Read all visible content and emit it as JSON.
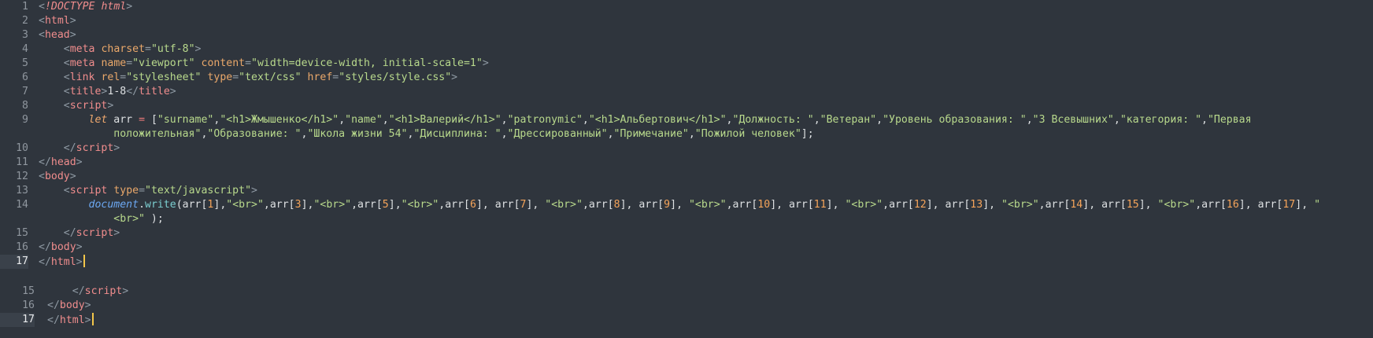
{
  "top": {
    "lines": [
      {
        "n": "1",
        "tokens": [
          [
            "b",
            "<"
          ],
          [
            "doc",
            "!DOCTYPE"
          ],
          [
            "p",
            " "
          ],
          [
            "doc",
            "html"
          ],
          [
            "b",
            ">"
          ]
        ]
      },
      {
        "n": "2",
        "tokens": [
          [
            "b",
            "<"
          ],
          [
            "t",
            "html"
          ],
          [
            "b",
            ">"
          ]
        ]
      },
      {
        "n": "3",
        "tokens": [
          [
            "b",
            "<"
          ],
          [
            "t",
            "head"
          ],
          [
            "b",
            ">"
          ]
        ]
      },
      {
        "n": "4",
        "tokens": [
          [
            "p",
            "    "
          ],
          [
            "b",
            "<"
          ],
          [
            "t",
            "meta"
          ],
          [
            "p",
            " "
          ],
          [
            "a",
            "charset"
          ],
          [
            "b",
            "="
          ],
          [
            "s",
            "\"utf-8\""
          ],
          [
            "b",
            ">"
          ]
        ]
      },
      {
        "n": "5",
        "tokens": [
          [
            "p",
            "    "
          ],
          [
            "b",
            "<"
          ],
          [
            "t",
            "meta"
          ],
          [
            "p",
            " "
          ],
          [
            "a",
            "name"
          ],
          [
            "b",
            "="
          ],
          [
            "s",
            "\"viewport\""
          ],
          [
            "p",
            " "
          ],
          [
            "a",
            "content"
          ],
          [
            "b",
            "="
          ],
          [
            "s",
            "\"width=device-width, initial-scale=1\""
          ],
          [
            "b",
            ">"
          ]
        ]
      },
      {
        "n": "6",
        "tokens": [
          [
            "p",
            "    "
          ],
          [
            "b",
            "<"
          ],
          [
            "t",
            "link"
          ],
          [
            "p",
            " "
          ],
          [
            "a",
            "rel"
          ],
          [
            "b",
            "="
          ],
          [
            "s",
            "\"stylesheet\""
          ],
          [
            "p",
            " "
          ],
          [
            "a",
            "type"
          ],
          [
            "b",
            "="
          ],
          [
            "s",
            "\"text/css\""
          ],
          [
            "p",
            " "
          ],
          [
            "a",
            "href"
          ],
          [
            "b",
            "="
          ],
          [
            "s",
            "\"styles/style.css\""
          ],
          [
            "b",
            ">"
          ]
        ]
      },
      {
        "n": "7",
        "tokens": [
          [
            "p",
            "    "
          ],
          [
            "b",
            "<"
          ],
          [
            "t",
            "title"
          ],
          [
            "b",
            ">"
          ],
          [
            "p",
            "1-8"
          ],
          [
            "b",
            "</"
          ],
          [
            "t",
            "title"
          ],
          [
            "b",
            ">"
          ]
        ]
      },
      {
        "n": "8",
        "tokens": [
          [
            "p",
            "    "
          ],
          [
            "b",
            "<"
          ],
          [
            "t",
            "script"
          ],
          [
            "b",
            ">"
          ]
        ]
      },
      {
        "n": "9",
        "tokens": [
          [
            "p",
            "        "
          ],
          [
            "k",
            "let"
          ],
          [
            "p",
            " arr "
          ],
          [
            "o",
            "="
          ],
          [
            "p",
            " ["
          ],
          [
            "s",
            "\"surname\""
          ],
          [
            "p",
            ","
          ],
          [
            "s",
            "\"<h1>Жмышенко</h1>\""
          ],
          [
            "p",
            ","
          ],
          [
            "s",
            "\"name\""
          ],
          [
            "p",
            ","
          ],
          [
            "s",
            "\"<h1>Валерий</h1>\""
          ],
          [
            "p",
            ","
          ],
          [
            "s",
            "\"patronymic\""
          ],
          [
            "p",
            ","
          ],
          [
            "s",
            "\"<h1>Альбертович</h1>\""
          ],
          [
            "p",
            ","
          ],
          [
            "s",
            "\"Должность: \""
          ],
          [
            "p",
            ","
          ],
          [
            "s",
            "\"Ветеран\""
          ],
          [
            "p",
            ","
          ],
          [
            "s",
            "\"Уровень образования: \""
          ],
          [
            "p",
            ","
          ],
          [
            "s",
            "\"3 Всевышних\""
          ],
          [
            "p",
            ","
          ],
          [
            "s",
            "\"категория: \""
          ],
          [
            "p",
            ","
          ],
          [
            "s",
            "\"Первая"
          ]
        ]
      },
      {
        "n": "",
        "tokens": [
          [
            "p",
            "            "
          ],
          [
            "s",
            "положительная\""
          ],
          [
            "p",
            ","
          ],
          [
            "s",
            "\"Образование: \""
          ],
          [
            "p",
            ","
          ],
          [
            "s",
            "\"Школа жизни 54\""
          ],
          [
            "p",
            ","
          ],
          [
            "s",
            "\"Дисциплина: \""
          ],
          [
            "p",
            ","
          ],
          [
            "s",
            "\"Дрессированный\""
          ],
          [
            "p",
            ","
          ],
          [
            "s",
            "\"Примечание\""
          ],
          [
            "p",
            ","
          ],
          [
            "s",
            "\"Пожилой человек\""
          ],
          [
            "p",
            "];"
          ]
        ]
      },
      {
        "n": "10",
        "tokens": [
          [
            "p",
            "    "
          ],
          [
            "b",
            "</"
          ],
          [
            "t",
            "script"
          ],
          [
            "b",
            ">"
          ]
        ]
      },
      {
        "n": "11",
        "tokens": [
          [
            "b",
            "</"
          ],
          [
            "t",
            "head"
          ],
          [
            "b",
            ">"
          ]
        ]
      },
      {
        "n": "12",
        "tokens": [
          [
            "b",
            "<"
          ],
          [
            "t",
            "body"
          ],
          [
            "b",
            ">"
          ]
        ]
      },
      {
        "n": "13",
        "tokens": [
          [
            "p",
            "    "
          ],
          [
            "b",
            "<"
          ],
          [
            "t",
            "script"
          ],
          [
            "p",
            " "
          ],
          [
            "a",
            "type"
          ],
          [
            "b",
            "="
          ],
          [
            "s",
            "\"text/javascript\""
          ],
          [
            "b",
            ">"
          ]
        ]
      },
      {
        "n": "14",
        "tokens": [
          [
            "p",
            "        "
          ],
          [
            "d",
            "document"
          ],
          [
            "p",
            "."
          ],
          [
            "f",
            "write"
          ],
          [
            "p",
            "(arr["
          ],
          [
            "n",
            "1"
          ],
          [
            "p",
            "],"
          ],
          [
            "s",
            "\"<br>\""
          ],
          [
            "p",
            ",arr["
          ],
          [
            "n",
            "3"
          ],
          [
            "p",
            "],"
          ],
          [
            "s",
            "\"<br>\""
          ],
          [
            "p",
            ",arr["
          ],
          [
            "n",
            "5"
          ],
          [
            "p",
            "],"
          ],
          [
            "s",
            "\"<br>\""
          ],
          [
            "p",
            ",arr["
          ],
          [
            "n",
            "6"
          ],
          [
            "p",
            "], arr["
          ],
          [
            "n",
            "7"
          ],
          [
            "p",
            "], "
          ],
          [
            "s",
            "\"<br>\""
          ],
          [
            "p",
            ",arr["
          ],
          [
            "n",
            "8"
          ],
          [
            "p",
            "], arr["
          ],
          [
            "n",
            "9"
          ],
          [
            "p",
            "], "
          ],
          [
            "s",
            "\"<br>\""
          ],
          [
            "p",
            ",arr["
          ],
          [
            "n",
            "10"
          ],
          [
            "p",
            "], arr["
          ],
          [
            "n",
            "11"
          ],
          [
            "p",
            "], "
          ],
          [
            "s",
            "\"<br>\""
          ],
          [
            "p",
            ",arr["
          ],
          [
            "n",
            "12"
          ],
          [
            "p",
            "], arr["
          ],
          [
            "n",
            "13"
          ],
          [
            "p",
            "], "
          ],
          [
            "s",
            "\"<br>\""
          ],
          [
            "p",
            ",arr["
          ],
          [
            "n",
            "14"
          ],
          [
            "p",
            "], arr["
          ],
          [
            "n",
            "15"
          ],
          [
            "p",
            "], "
          ],
          [
            "s",
            "\"<br>\""
          ],
          [
            "p",
            ",arr["
          ],
          [
            "n",
            "16"
          ],
          [
            "p",
            "], arr["
          ],
          [
            "n",
            "17"
          ],
          [
            "p",
            "], "
          ],
          [
            "s",
            "\""
          ]
        ]
      },
      {
        "n": "",
        "tokens": [
          [
            "p",
            "            "
          ],
          [
            "s",
            "<br>\""
          ],
          [
            "p",
            " );"
          ]
        ]
      },
      {
        "n": "15",
        "tokens": [
          [
            "p",
            "    "
          ],
          [
            "b",
            "</"
          ],
          [
            "t",
            "script"
          ],
          [
            "b",
            ">"
          ]
        ]
      },
      {
        "n": "16",
        "tokens": [
          [
            "b",
            "</"
          ],
          [
            "t",
            "body"
          ],
          [
            "b",
            ">"
          ]
        ]
      },
      {
        "n": "17",
        "active": true,
        "cursor": true,
        "tokens": [
          [
            "b",
            "</"
          ],
          [
            "t",
            "html"
          ],
          [
            "b",
            ">"
          ]
        ]
      }
    ]
  },
  "bottom": {
    "lines": [
      {
        "n": "15",
        "tokens": [
          [
            "p",
            "    "
          ],
          [
            "b",
            "</"
          ],
          [
            "t",
            "script"
          ],
          [
            "b",
            ">"
          ]
        ]
      },
      {
        "n": "16",
        "tokens": [
          [
            "b",
            "</"
          ],
          [
            "t",
            "body"
          ],
          [
            "b",
            ">"
          ]
        ]
      },
      {
        "n": "17",
        "active": true,
        "cursor": true,
        "tokens": [
          [
            "b",
            "</"
          ],
          [
            "t",
            "html"
          ],
          [
            "b",
            ">"
          ]
        ]
      }
    ]
  }
}
